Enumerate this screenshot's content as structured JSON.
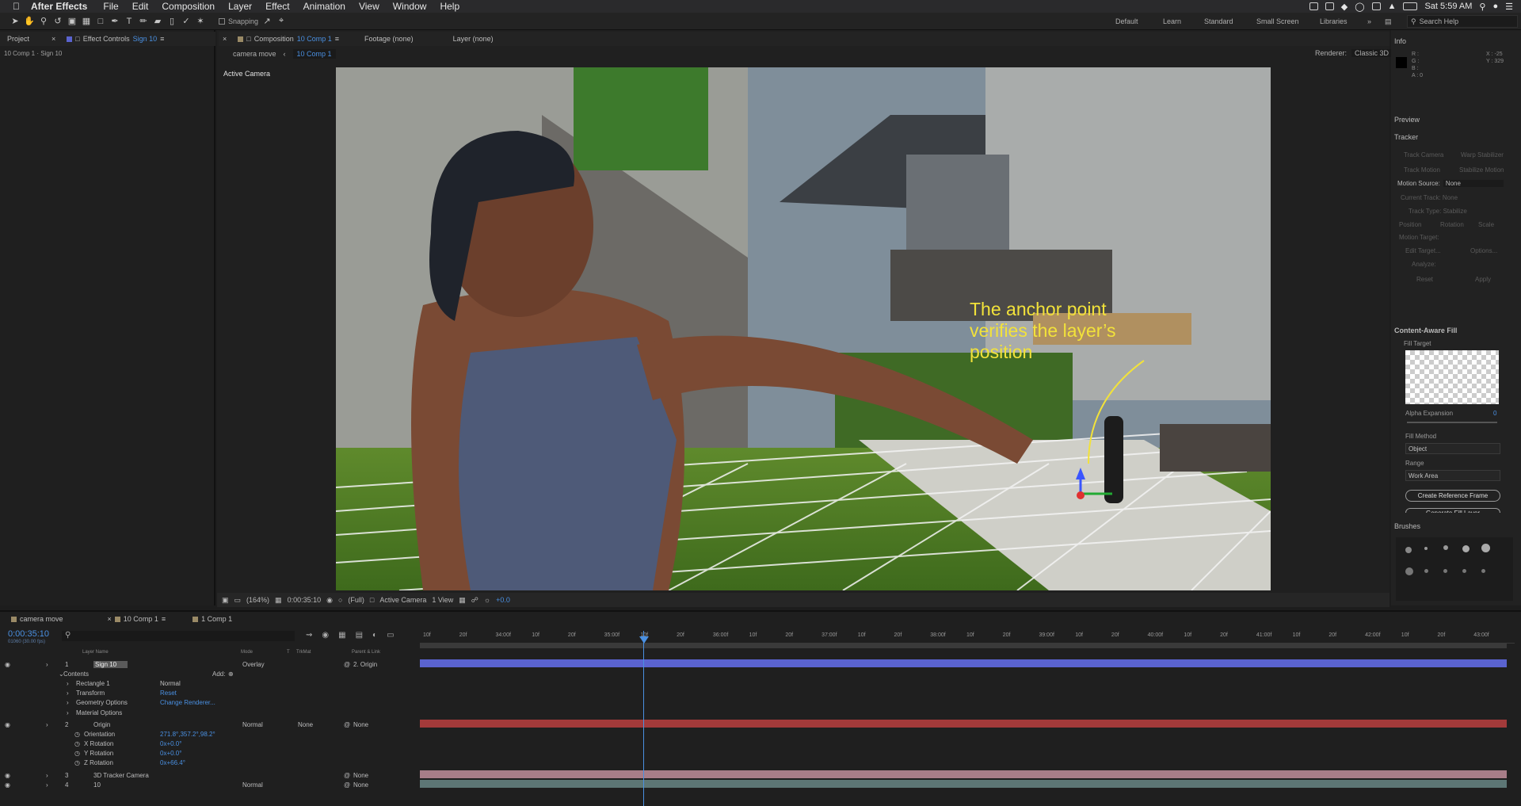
{
  "menubar": {
    "app": "After Effects",
    "items": [
      "File",
      "Edit",
      "Composition",
      "Layer",
      "Effect",
      "Animation",
      "View",
      "Window",
      "Help"
    ],
    "clock": "Sat 5:59 AM"
  },
  "toolbar": {
    "snapping_label": "Snapping",
    "workspaces": [
      "Default",
      "Learn",
      "Standard",
      "Small Screen",
      "Libraries"
    ],
    "search_placeholder": "Search Help"
  },
  "left_panel": {
    "tab_project": "Project",
    "tab_effect_controls": "Effect Controls",
    "effect_controls_layer": "Sign 10",
    "breadcrumb": "10 Comp 1 · Sign 10"
  },
  "comp_panel": {
    "tab_composition": "Composition",
    "tab_composition_name": "10 Comp 1",
    "tab_footage": "Footage (none)",
    "tab_layer": "Layer (none)",
    "flow": [
      "camera move",
      "10 Comp 1"
    ],
    "renderer_label": "Renderer:",
    "renderer_value": "Classic 3D",
    "view_label": "Active Camera",
    "annotation_lines": [
      "The anchor point",
      "verifies the layer’s",
      "position"
    ]
  },
  "comp_footer": {
    "zoom": "(164%)",
    "timecode": "0:00:35:10",
    "resolution": "(Full)",
    "camera": "Active Camera",
    "views": "1 View",
    "exposure": "+0.0"
  },
  "info_panel": {
    "title": "Info",
    "rgba_labels": [
      "R :",
      "G :",
      "B :",
      "A : 0"
    ],
    "x": "X : -25",
    "y": "Y : 329"
  },
  "preview_panel": {
    "title": "Preview"
  },
  "tracker_panel": {
    "title": "Tracker",
    "buttons": [
      "Track Camera",
      "Warp Stabilizer",
      "Track Motion",
      "Stabilize Motion"
    ],
    "motion_source_label": "Motion Source:",
    "motion_source_value": "None",
    "current_track": "Current Track:  None",
    "track_type": "Track Type:  Stabilize",
    "checks": [
      "Position",
      "Rotation",
      "Scale"
    ],
    "motion_target": "Motion Target:",
    "edit_target": "Edit Target...",
    "options": "Options...",
    "analyze": "Analyze:",
    "reset": "Reset",
    "apply": "Apply"
  },
  "caf_panel": {
    "title": "Content-Aware Fill",
    "fill_target": "Fill Target",
    "alpha_expansion": "Alpha Expansion",
    "alpha_value": "0",
    "fill_method": "Fill Method",
    "fill_method_value": "Object",
    "range": "Range",
    "range_value": "Work Area",
    "create_reference": "Create Reference Frame",
    "generate_fill": "Generate Fill Layer"
  },
  "brushes_panel": {
    "title": "Brushes",
    "sizes": [
      "1",
      "3",
      "5",
      "9",
      "13",
      "19",
      "5",
      "9",
      "13",
      "17",
      "21",
      "27",
      "35",
      "45",
      "65"
    ]
  },
  "timeline": {
    "tabs": [
      "camera move",
      "10 Comp 1",
      "1 Comp 1"
    ],
    "timecode": "0:00:35:10",
    "fps": "01060 (30.00 fps)",
    "columns": [
      "Layer Name",
      "Mode",
      "T",
      "TrkMat",
      "Parent & Link"
    ],
    "ruler": [
      "10f",
      "20f",
      "34:00f",
      "10f",
      "20f",
      "35:00f",
      "10f",
      "20f",
      "36:00f",
      "10f",
      "20f",
      "37:00f",
      "10f",
      "20f",
      "38:00f",
      "10f",
      "20f",
      "39:00f",
      "10f",
      "20f",
      "40:00f",
      "10f",
      "20f",
      "41:00f",
      "10f",
      "20f",
      "42:00f",
      "10f",
      "20f",
      "43:00f"
    ],
    "rows": [
      {
        "num": "1",
        "name": "Sign 10",
        "mode": "Overlay",
        "parent": "2. Origin",
        "kind": "layer"
      },
      {
        "name": "Contents",
        "add": "Add:",
        "kind": "group"
      },
      {
        "name": "Rectangle 1",
        "value": "Normal",
        "kind": "prop"
      },
      {
        "name": "Transform",
        "value": "Reset",
        "kind": "prop"
      },
      {
        "name": "Geometry Options",
        "value": "Change Renderer...",
        "kind": "prop"
      },
      {
        "name": "Material Options",
        "kind": "prop"
      },
      {
        "num": "2",
        "name": "Origin",
        "mode": "Normal",
        "trkmat": "None",
        "parent": "None",
        "kind": "layer"
      },
      {
        "name": "Orientation",
        "value": "271.8°,357.2°,98.2°",
        "kind": "prop"
      },
      {
        "name": "X Rotation",
        "value": "0x+0.0°",
        "kind": "prop"
      },
      {
        "name": "Y Rotation",
        "value": "0x+0.0°",
        "kind": "prop"
      },
      {
        "name": "Z Rotation",
        "value": "0x+66.4°",
        "kind": "prop"
      },
      {
        "num": "3",
        "name": "3D Tracker Camera",
        "parent": "None",
        "kind": "layer"
      },
      {
        "num": "4",
        "name": "10",
        "mode": "Normal",
        "parent": "None",
        "kind": "layer"
      }
    ]
  },
  "colors": {
    "accent": "#4a90e2",
    "blue_bar": "#5a63cf",
    "red_bar": "#a33a3a",
    "pink_bar": "#a77d88",
    "teal_bar": "#5d7675",
    "annotation": "#f2e23a"
  }
}
